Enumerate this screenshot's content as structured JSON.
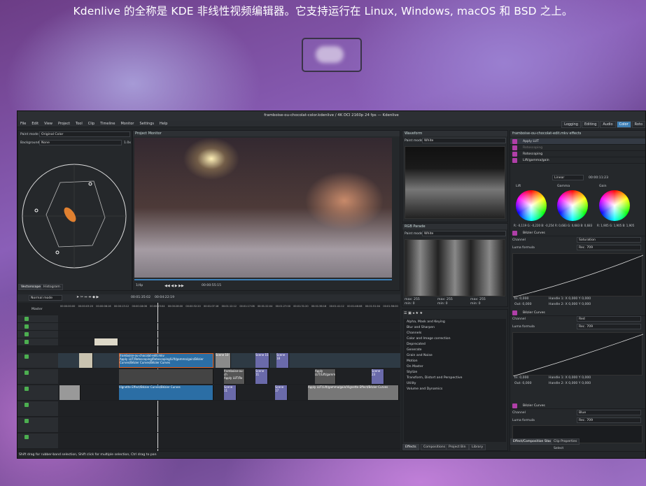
{
  "page": {
    "headline": "Kdenlive 的全称是 KDE 非线性视频编辑器。它支持运行在 Linux, Windows, macOS 和 BSD 之上。"
  },
  "window": {
    "title": "framboise-ou-chocolat-color.kdenlive / 4K DCI 2160p 24 fps — Kdenlive",
    "menu": [
      "File",
      "Edit",
      "View",
      "Project",
      "Tool",
      "Clip",
      "Timeline",
      "Monitor",
      "Settings",
      "Help"
    ],
    "workspaces": [
      "Logging",
      "Editing",
      "Audio",
      "Color",
      "Roto"
    ],
    "active_workspace": "Color"
  },
  "vectorscope": {
    "paint_mode_label": "Paint mode",
    "paint_mode_value": "Original Color",
    "background_label": "Background",
    "background_value": "None",
    "zoom": "1.0x",
    "tabs": [
      "Vectorscope",
      "Histogram"
    ]
  },
  "monitor": {
    "title": "Project Monitor",
    "zoom": "1/4p",
    "timecode": "00:00:55:15"
  },
  "waveform": {
    "title": "Waveform",
    "paint_mode_label": "Paint mode",
    "paint_mode_value": "White"
  },
  "rgb_parade": {
    "title": "RGB Parade",
    "paint_mode_label": "Paint mode",
    "paint_mode_value": "White",
    "stats": [
      "max: 255",
      "max: 255",
      "max: 255",
      "min: 0",
      "min: 0",
      "min: 0"
    ]
  },
  "effects_list": {
    "categories": [
      "Alpha, Mask and Keying",
      "Blur and Sharpen",
      "Channels",
      "Color and Image correction",
      "Deprecated",
      "Generate",
      "Grain and Noise",
      "Motion",
      "On Master",
      "Stylize",
      "Transform, Distort and Perspective",
      "Utility",
      "Volume and Dynamics"
    ],
    "tabs": [
      "Effects",
      "Compositions",
      "Project Bin",
      "Library"
    ]
  },
  "effect_stack": {
    "title": "framboise-ou-chocolat-edit.mkv effects",
    "effects": [
      "Apply LUT",
      "Rotoscoping",
      "Rotoscoping",
      "Lift/gamma/gain"
    ],
    "interp": "Linear",
    "timecode": "00:00:11:23",
    "wheels": [
      {
        "name": "Lift",
        "values": "R: -0,119  G: -0,220  B: -0,254"
      },
      {
        "name": "Gamma",
        "values": "R: 0,683  G: 0,683  B: 0,683"
      },
      {
        "name": "Gain",
        "values": "R: 1,905  G: 1,905  B: 1,905"
      }
    ],
    "curves": [
      {
        "title": "Bézier Curves",
        "channel_label": "Channel",
        "channel": "Saturation",
        "luma_label": "Luma formula",
        "luma": "Rec. 709",
        "in": "In: 0,000",
        "out": "Out: 0,000",
        "h1": "Handle 1: X 0,000  Y 0,000",
        "h2": "Handle 2: X 0,000  Y 0,000"
      },
      {
        "title": "Bézier Curves",
        "channel_label": "Channel",
        "channel": "Red",
        "luma_label": "Luma formula",
        "luma": "Rec. 709",
        "in": "In: 0,000",
        "out": "Out: 0,000",
        "h1": "Handle 1: X 0,000  Y 0,000",
        "h2": "Handle 2: X 0,000  Y 0,000"
      },
      {
        "title": "Bézier Curves",
        "channel_label": "Channel",
        "channel": "Blue",
        "luma_label": "Luma formula",
        "luma": "Rec. 709"
      }
    ],
    "bottom_tabs": [
      "Effect/Composition Stack",
      "Clip Properties"
    ],
    "select_label": "Select"
  },
  "timeline": {
    "mode": "Normal mode",
    "position": "00:01:35:02",
    "duration": "00:04:22:19",
    "master": "Master",
    "ruler": [
      "00:00:00:00",
      "00:00:03:20",
      "00:00:08:16",
      "00:00:13:12",
      "00:00:18:08",
      "00:00:23:04",
      "00:00:28:00",
      "00:00:32:20",
      "00:01:07:16",
      "00:01:12:12",
      "00:01:17:08",
      "00:01:22:04",
      "00:01:27:00",
      "00:01:31:20",
      "00:01:36:16",
      "00:01:41:12",
      "00:01:46:08",
      "00:01:51:04",
      "00:01:56:00"
    ],
    "clip_labels": [
      "framboise-ou-chocolat-edit.mkv",
      "Apply LUT/Rotoscoping/Rotoscoping/Lift/gamma/gain/Bézier Curves/Bézier Curves/Bézier Curves",
      "Scene 10",
      "Scene 15",
      "Scene 18",
      "framboise-ou-ch",
      "Apply LUT/Ro",
      "Scene 11",
      "Apply LUT/Lift/gamma/gain",
      "Scene 23",
      "Vignette Effect/Bézier Curves/Bézier Curves",
      "Scene 11",
      "Scene 17",
      "Apply LUT/Lift/gamma/gain/Vignette Effect/Bézier Curves"
    ]
  },
  "status_bar": "Shift drag for rubber-band selection, Shift click for multiple selection, Ctrl drag to pan"
}
